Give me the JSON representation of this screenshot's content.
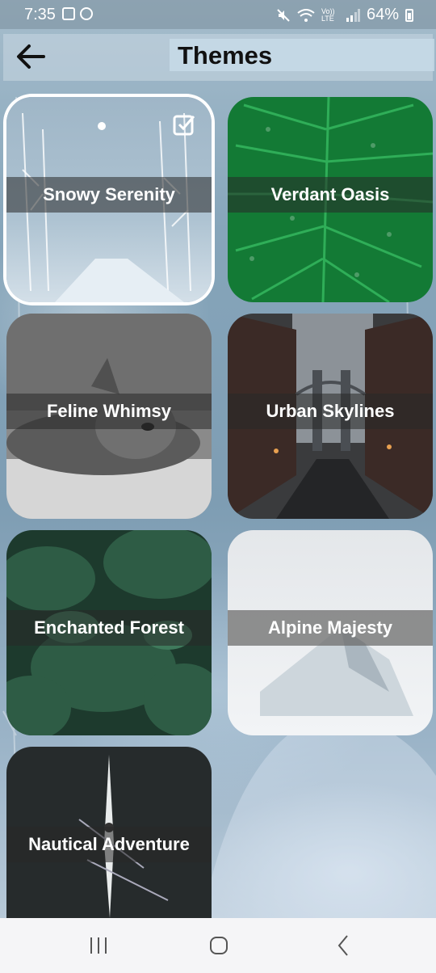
{
  "status_bar": {
    "time": "7:35",
    "battery": "64%",
    "icons_left": [
      "gallery-icon",
      "cloud-sync-icon"
    ],
    "icons_right": [
      "mute-icon",
      "wifi-icon",
      "volte-icon",
      "signal-icon",
      "battery-icon"
    ],
    "volte_text": "Vo)) LTE"
  },
  "header": {
    "title": "Themes",
    "back_icon": "arrow-left-icon"
  },
  "themes": [
    {
      "label": "Snowy Serenity",
      "selected": true
    },
    {
      "label": "Verdant Oasis",
      "selected": false
    },
    {
      "label": "Feline Whimsy",
      "selected": false
    },
    {
      "label": "Urban Skylines",
      "selected": false
    },
    {
      "label": "Enchanted Forest",
      "selected": false
    },
    {
      "label": "Alpine Majesty",
      "selected": false
    },
    {
      "label": "Nautical Adventure",
      "selected": false
    }
  ],
  "nav_bar": {
    "recents_icon": "recents-icon",
    "home_icon": "home-icon",
    "back_icon": "back-chevron-icon"
  }
}
